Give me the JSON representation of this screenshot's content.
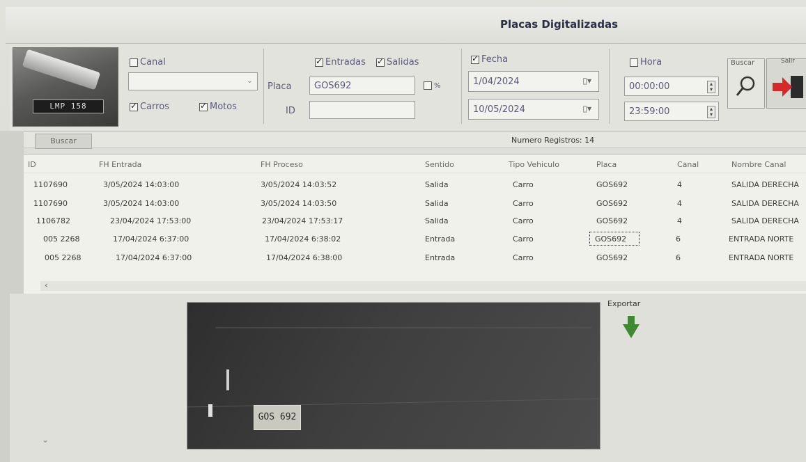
{
  "window": {
    "title": "Placas Digitalizadas"
  },
  "camera": {
    "plate_text": "LMP 158"
  },
  "filters": {
    "canal": {
      "label": "Canal",
      "checked": false,
      "select_value": ""
    },
    "carros": {
      "label": "Carros",
      "checked": true
    },
    "motos": {
      "label": "Motos",
      "checked": true
    },
    "entradas": {
      "label": "Entradas",
      "checked": true
    },
    "salidas": {
      "label": "Salidas",
      "checked": true
    },
    "placa": {
      "label": "Placa",
      "value": "GOS692"
    },
    "id": {
      "label": "ID",
      "value": ""
    },
    "percent": {
      "label": "%",
      "checked": false
    },
    "fecha": {
      "label": "Fecha",
      "checked": true,
      "from": "1/04/2024",
      "to": "10/05/2024"
    },
    "hora": {
      "label": "Hora",
      "checked": false,
      "from": "00:00:00",
      "to": "23:59:00"
    }
  },
  "buttons": {
    "buscar": "Buscar",
    "salir": "Salir"
  },
  "results": {
    "tab_label": "Buscar",
    "count_label": "Numero Registros: 14",
    "columns": [
      "ID",
      "FH Entrada",
      "FH Proceso",
      "Sentido",
      "Tipo Vehiculo",
      "Placa",
      "Canal",
      "Nombre Canal"
    ],
    "rows": [
      [
        "1107690",
        "3/05/2024 14:03:00",
        "3/05/2024 14:03:52",
        "Salida",
        "Carro",
        "GOS692",
        "4",
        "SALIDA DERECHA"
      ],
      [
        "1107690",
        "3/05/2024 14:03:00",
        "3/05/2024 14:03:50",
        "Salida",
        "Carro",
        "GOS692",
        "4",
        "SALIDA DERECHA"
      ],
      [
        "1106782",
        "23/04/2024 17:53:00",
        "23/04/2024 17:53:17",
        "Salida",
        "Carro",
        "GOS692",
        "4",
        "SALIDA DERECHA"
      ],
      [
        "005 2268",
        "17/04/2024 6:37:00",
        "17/04/2024 6:38:02",
        "Entrada",
        "Carro",
        "GOS692",
        "6",
        "ENTRADA NORTE"
      ],
      [
        "005 2268",
        "17/04/2024 6:37:00",
        "17/04/2024 6:38:00",
        "Entrada",
        "Carro",
        "GOS692",
        "6",
        "ENTRADA NORTE"
      ]
    ]
  },
  "photo": {
    "plate_text": "GOS 692"
  },
  "export": {
    "label": "Exportar"
  }
}
